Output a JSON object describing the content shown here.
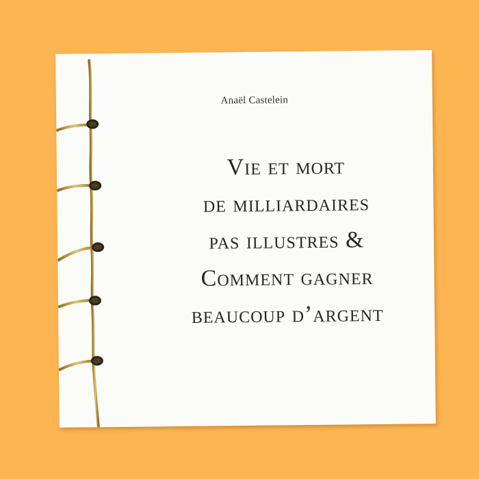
{
  "booklet": {
    "author": "Anaël Castelein",
    "title_lines": [
      "Vie et mort",
      "de milliardaires",
      "pas illustres &",
      "Comment gagner",
      "beaucoup d’argent"
    ]
  },
  "colors": {
    "background": "#fdb552",
    "paper": "#fbfcf8",
    "ink": "#262626",
    "binding_cord": "#b8923a",
    "binding_hole": "#2a2418"
  },
  "binding": {
    "stitch_count": 5
  }
}
